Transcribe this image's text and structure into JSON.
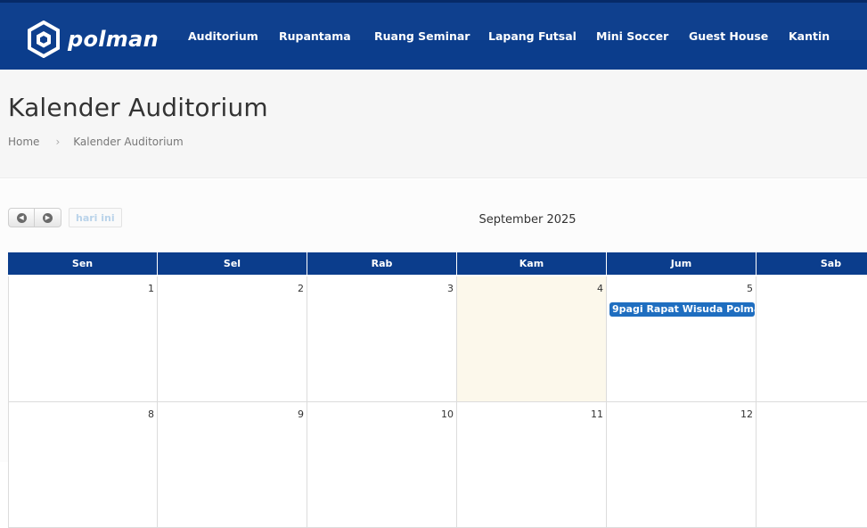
{
  "brand": {
    "name": "polman",
    "logo_icon": "polman-logo-icon"
  },
  "nav": {
    "items": [
      "Auditorium",
      "Rupantama",
      "Ruang Seminar",
      "Lapang Futsal",
      "Mini Soccer",
      "Guest House",
      "Kantin"
    ]
  },
  "header": {
    "title": "Kalender Auditorium",
    "breadcrumb": {
      "home": "Home",
      "separator": "›",
      "current": "Kalender Auditorium"
    }
  },
  "calendar": {
    "month_label": "September 2025",
    "today_label": "hari ini",
    "prev_icon": "chevron-left-icon",
    "next_icon": "chevron-right-icon",
    "weekdays": [
      "Sen",
      "Sel",
      "Rab",
      "Kam",
      "Jum",
      "Sab"
    ],
    "weeks": [
      [
        "1",
        "2",
        "3",
        "4",
        "5",
        ""
      ],
      [
        "8",
        "9",
        "10",
        "11",
        "12",
        ""
      ]
    ],
    "today_day": "4",
    "events": [
      {
        "day": "5",
        "time": "9pagi",
        "title": "Rapat Wisuda Polman Tah"
      }
    ]
  },
  "colors": {
    "primary": "#0b3d8c",
    "event": "#1f6ec0",
    "today_bg": "#fcf8eb"
  }
}
